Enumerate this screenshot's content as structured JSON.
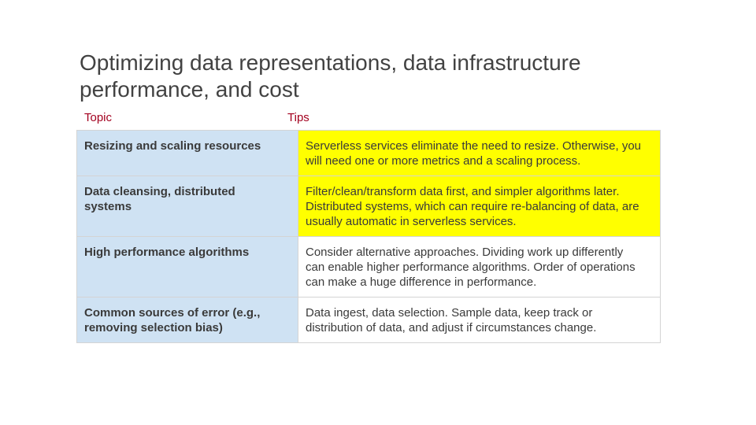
{
  "slide": {
    "title_line1": "Optimizing data representations, data infrastructure",
    "title_line2": "performance, and cost"
  },
  "table": {
    "headers": {
      "topic": "Topic",
      "tips": "Tips"
    },
    "rows": [
      {
        "topic_lines": [
          "Resizing and scaling resources"
        ],
        "tip_lines": [
          "Serverless services eliminate the need to resize. Otherwise, you",
          "will need one or more metrics and a scaling process."
        ],
        "highlighted": true,
        "highlight_color": "#ffff00"
      },
      {
        "topic_lines": [
          "Data cleansing, distributed",
          "systems"
        ],
        "tip_lines": [
          "Filter/clean/transform data first, and simpler algorithms later.",
          "Distributed systems, which can require re-balancing of data, are",
          "usually automatic in serverless services."
        ],
        "highlighted": true,
        "highlight_color": "#ffff00"
      },
      {
        "topic_lines": [
          "High performance algorithms"
        ],
        "tip_lines": [
          "Consider alternative approaches. Dividing work up differently",
          "can enable higher performance algorithms. Order of operations",
          "can make a huge difference in performance."
        ],
        "highlighted": false
      },
      {
        "topic_lines": [
          "Common sources of error (e.g.,",
          "removing selection bias)"
        ],
        "tip_lines": [
          "Data ingest, data selection. Sample data, keep track or",
          "distribution of data, and adjust if circumstances change."
        ],
        "highlighted": false
      }
    ]
  },
  "colors": {
    "topic_cell_bg": "#cfe2f3",
    "header_text": "#a3001f",
    "highlight": "#ffff00"
  }
}
